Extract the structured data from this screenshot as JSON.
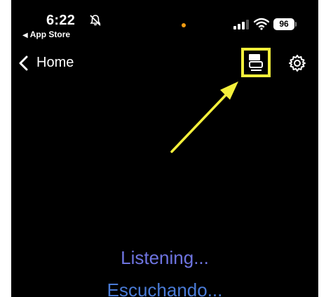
{
  "status_bar": {
    "time": "6:22",
    "back_app": "App Store",
    "battery": "96"
  },
  "nav": {
    "back_label": "Home"
  },
  "icons": {
    "silent": "bell-slash-icon",
    "signal": "cellular-signal-icon",
    "wifi": "wifi-icon",
    "subtitles": "subtitles-icon",
    "settings": "gear-icon",
    "back": "chevron-left-icon"
  },
  "colors": {
    "highlight": "#f4f03b",
    "arrow": "#f4f03b",
    "listening_en": "#6e74e0",
    "listening_es": "#4a7bd6",
    "mic_dot": "#f39c12"
  },
  "main": {
    "listening_en": "Listening...",
    "listening_es": "Escuchando..."
  }
}
